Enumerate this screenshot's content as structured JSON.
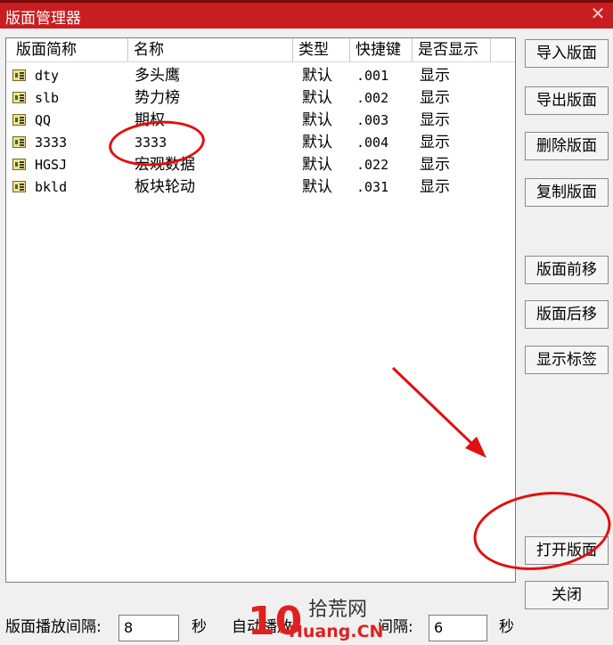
{
  "window": {
    "title": "版面管理器",
    "close_glyph": "✕"
  },
  "columns": [
    "版面简称",
    "名称",
    "类型",
    "快捷键",
    "是否显示"
  ],
  "rows": [
    {
      "abbr": "dty",
      "name": "多头鹰",
      "type": "默认",
      "hotkey": ".001",
      "show": "显示"
    },
    {
      "abbr": "slb",
      "name": "势力榜",
      "type": "默认",
      "hotkey": ".002",
      "show": "显示"
    },
    {
      "abbr": "QQ",
      "name": "期权",
      "type": "默认",
      "hotkey": ".003",
      "show": "显示"
    },
    {
      "abbr": "3333",
      "name": "3333",
      "type": "默认",
      "hotkey": ".004",
      "show": "显示"
    },
    {
      "abbr": "HGSJ",
      "name": "宏观数据",
      "type": "默认",
      "hotkey": ".022",
      "show": "显示"
    },
    {
      "abbr": "bkld",
      "name": "板块轮动",
      "type": "默认",
      "hotkey": ".031",
      "show": "显示"
    }
  ],
  "buttons": {
    "import": "导入版面",
    "export": "导出版面",
    "delete": "删除版面",
    "copy": "复制版面",
    "move_up": "版面前移",
    "move_down": "版面后移",
    "show_tags": "显示标签",
    "open": "打开版面",
    "close": "关闭"
  },
  "bottom": {
    "play_interval_label": "版面播放间隔:",
    "play_interval_value": "8",
    "play_unit": "秒",
    "auto_label": "自动播放",
    "scroll_interval_label": "间隔:",
    "scroll_interval_value": "6",
    "scroll_unit": "秒"
  },
  "watermark": {
    "number": "10",
    "cn": "拾荒网",
    "en": "Huang.CN"
  },
  "colors": {
    "title_bg": "#c81d21",
    "annotation_red": "#e01010"
  }
}
